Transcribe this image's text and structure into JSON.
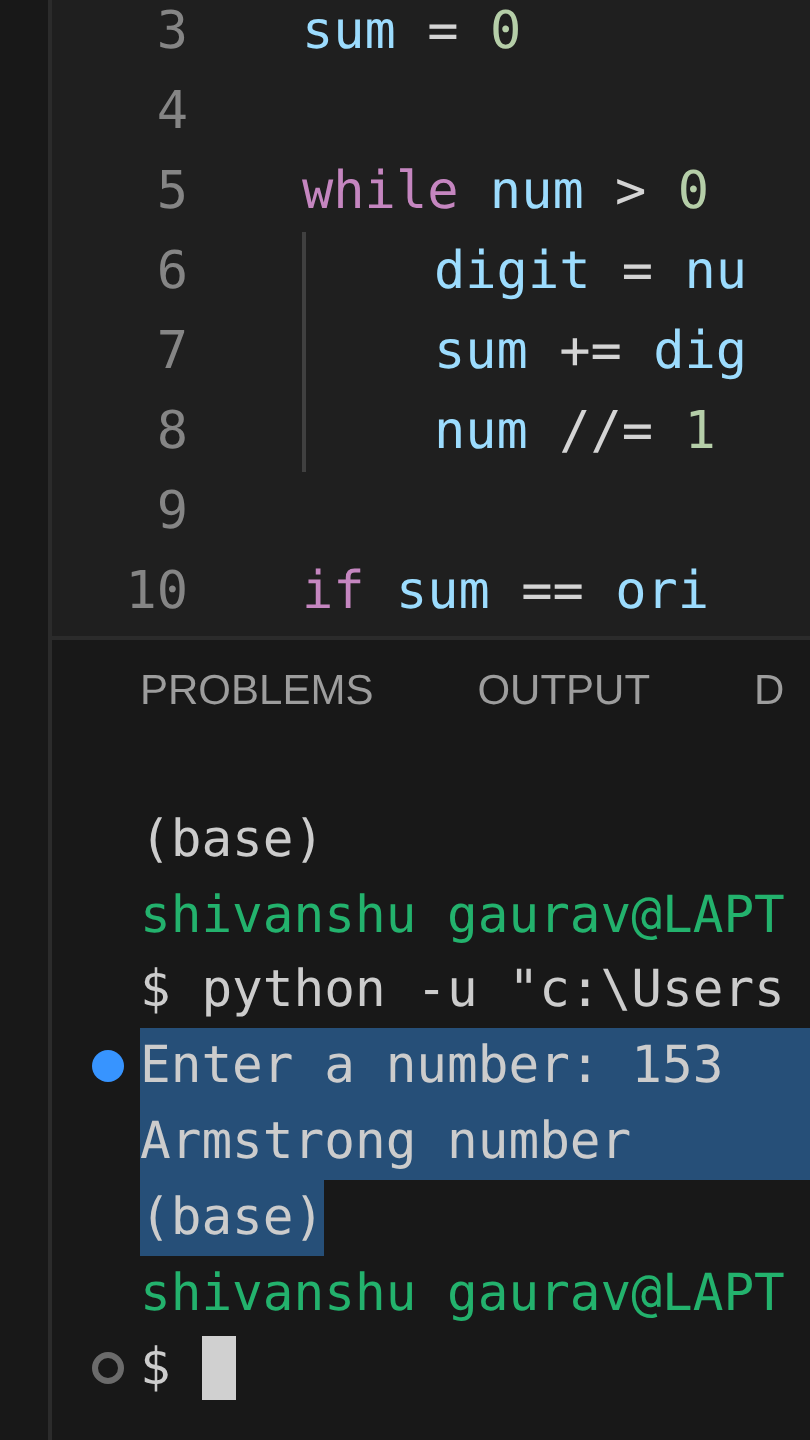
{
  "editor": {
    "lines": [
      {
        "number": "3",
        "indented": false,
        "tokens": [
          {
            "kind": "variable",
            "text": "sum"
          },
          {
            "kind": "operator",
            "text": " = "
          },
          {
            "kind": "number",
            "text": "0"
          }
        ]
      },
      {
        "number": "4",
        "indented": false
      },
      {
        "number": "5",
        "indented": false,
        "tokens": [
          {
            "kind": "keyword",
            "text": "while"
          },
          {
            "kind": "variable",
            "text": " num"
          },
          {
            "kind": "operator",
            "text": " > "
          },
          {
            "kind": "number",
            "text": "0"
          }
        ]
      },
      {
        "number": "6",
        "indented": true,
        "tokens": [
          {
            "kind": "variable",
            "text": "digit"
          },
          {
            "kind": "operator",
            "text": " = "
          },
          {
            "kind": "variable",
            "text": "nu"
          }
        ]
      },
      {
        "number": "7",
        "indented": true,
        "tokens": [
          {
            "kind": "variable",
            "text": "sum"
          },
          {
            "kind": "operator",
            "text": " += "
          },
          {
            "kind": "variable",
            "text": "dig"
          }
        ]
      },
      {
        "number": "8",
        "indented": true,
        "tokens": [
          {
            "kind": "variable",
            "text": "num"
          },
          {
            "kind": "operator",
            "text": " //= "
          },
          {
            "kind": "number",
            "text": "1"
          }
        ]
      },
      {
        "number": "9",
        "indented": false
      },
      {
        "number": "10",
        "indented": false,
        "tokens": [
          {
            "kind": "keyword",
            "text": "if"
          },
          {
            "kind": "variable",
            "text": " sum"
          },
          {
            "kind": "operator",
            "text": " == "
          },
          {
            "kind": "variable",
            "text": "ori"
          }
        ]
      }
    ]
  },
  "panel": {
    "tabs": [
      "PROBLEMS",
      "OUTPUT",
      "D"
    ],
    "terminal": [
      {
        "kind": "plain",
        "text": "(base)",
        "selected": false,
        "selected_to_end": false,
        "has_dot": false
      },
      {
        "kind": "prompt",
        "text": "shivanshu gaurav@LAPT",
        "selected": false,
        "selected_to_end": false,
        "has_dot": false
      },
      {
        "kind": "plain",
        "text": "$ python -u \"c:\\Users",
        "selected": false,
        "selected_to_end": false,
        "has_dot": false
      },
      {
        "kind": "plain",
        "text": "Enter a number: 153",
        "selected": true,
        "selected_to_end": true,
        "has_dot": true,
        "dot_filled": true
      },
      {
        "kind": "plain",
        "text": "Armstrong number",
        "selected": true,
        "selected_to_end": true,
        "has_dot": false
      },
      {
        "kind": "plain",
        "text": "(base)",
        "selected": true,
        "selected_to_end": false,
        "has_dot": false
      },
      {
        "kind": "prompt",
        "text": "shivanshu gaurav@LAPT",
        "selected": false,
        "selected_to_end": false,
        "has_dot": false
      },
      {
        "kind": "plain",
        "text": "$",
        "selected": false,
        "selected_to_end": false,
        "has_dot": true,
        "dot_filled": false,
        "cursor": true
      }
    ]
  }
}
